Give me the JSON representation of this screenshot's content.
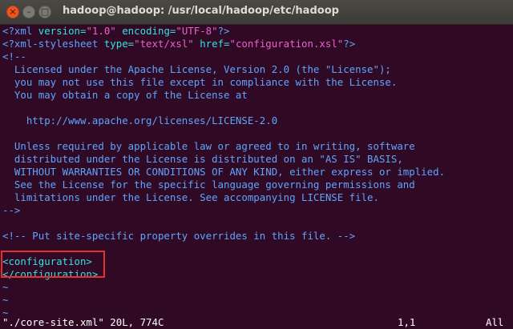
{
  "window": {
    "title": "hadoop@hadoop: /usr/local/hadoop/etc/hadoop",
    "close_glyph": "×",
    "minimize_glyph": "–",
    "maximize_glyph": "□"
  },
  "editor": {
    "xml_decl": {
      "open": "<?xml ",
      "version_attr": "version=",
      "version_val": "\"1.0\"",
      "encoding_attr": " encoding=",
      "encoding_val": "\"UTF-8\"",
      "close": "?>"
    },
    "stylesheet": {
      "open": "<?xml-stylesheet ",
      "type_attr": "type=",
      "type_val": "\"text/xsl\"",
      "href_attr": " href=",
      "href_val": "\"configuration.xsl\"",
      "close": "?>"
    },
    "comment_lines": [
      "<!--",
      "  Licensed under the Apache License, Version 2.0 (the \"License\");",
      "  you may not use this file except in compliance with the License.",
      "  You may obtain a copy of the License at",
      "",
      "    http://www.apache.org/licenses/LICENSE-2.0",
      "",
      "  Unless required by applicable law or agreed to in writing, software",
      "  distributed under the License is distributed on an \"AS IS\" BASIS,",
      "  WITHOUT WARRANTIES OR CONDITIONS OF ANY KIND, either express or implied.",
      "  See the License for the specific language governing permissions and",
      "  limitations under the License. See accompanying LICENSE file.",
      "-->"
    ],
    "site_comment": "<!-- Put site-specific property overrides in this file. -->",
    "config_open": "<configuration>",
    "config_close": "</configuration>",
    "tilde": "~"
  },
  "statusline": {
    "filename_info": "\"./core-site.xml\" 20L, 774C",
    "position": "1,1",
    "scroll": "All"
  },
  "colors": {
    "terminal_bg": "#300a24",
    "comment": "#5fa4ff",
    "string": "#ef5fd0",
    "tag": "#34e2e2",
    "highlight_border": "#e53030"
  }
}
